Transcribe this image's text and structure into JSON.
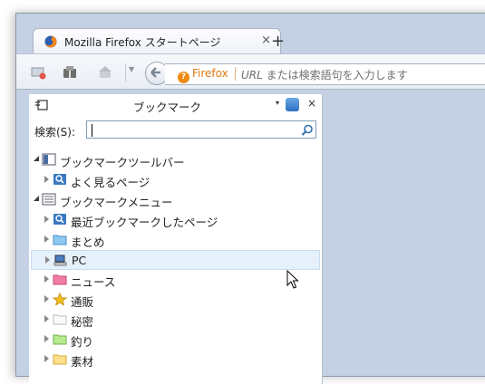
{
  "tab": {
    "title": "Mozilla Firefox スタートページ",
    "close": "×",
    "new_tab": "+"
  },
  "urlbar": {
    "identity": "Firefox",
    "placeholder_prefix": "URL",
    "placeholder_rest": " または検索語句を入力します"
  },
  "sidebar": {
    "title": "ブックマーク",
    "menu_arrow": "▾",
    "close": "×",
    "search_label": "検索(S):",
    "search_value": ""
  },
  "tree": [
    {
      "label": "ブックマークツールバー",
      "level": 0,
      "state": "open",
      "icon": "toolbar-icon"
    },
    {
      "label": "よく見るページ",
      "level": 1,
      "state": "closed",
      "icon": "smart-query-icon"
    },
    {
      "label": "ブックマークメニュー",
      "level": 0,
      "state": "open",
      "icon": "menu-icon"
    },
    {
      "label": "最近ブックマークしたページ",
      "level": 1,
      "state": "closed",
      "icon": "smart-query-icon"
    },
    {
      "label": "まとめ",
      "level": 1,
      "state": "closed",
      "icon": "folder-blue-icon"
    },
    {
      "label": "PC",
      "level": 1,
      "state": "closed",
      "icon": "pc-icon",
      "selected": true
    },
    {
      "label": "ニュース",
      "level": 1,
      "state": "closed",
      "icon": "folder-pink-icon"
    },
    {
      "label": "通販",
      "level": 1,
      "state": "closed",
      "icon": "star-icon"
    },
    {
      "label": "秘密",
      "level": 1,
      "state": "closed",
      "icon": "folder-white-icon"
    },
    {
      "label": "釣り",
      "level": 1,
      "state": "closed",
      "icon": "folder-green-icon"
    },
    {
      "label": "素材",
      "level": 1,
      "state": "closed",
      "icon": "folder-yellow-icon"
    }
  ],
  "colors": {
    "accent_orange": "#f08a12",
    "selection": "#e5f0fb",
    "chrome": "#c4d1e4"
  }
}
